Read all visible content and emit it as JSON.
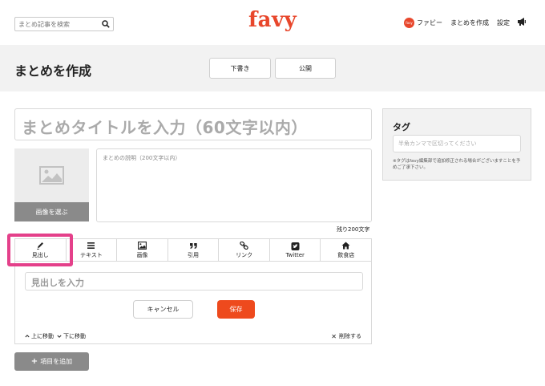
{
  "header": {
    "search_placeholder": "まとめ記事を検索",
    "logo": "favy",
    "avatar_text": "favy",
    "user_name": "ファビー",
    "nav_create": "まとめを作成",
    "nav_settings": "設定"
  },
  "band": {
    "title": "まとめを作成",
    "draft_label": "下書き",
    "publish_label": "公開"
  },
  "main": {
    "title_placeholder": "まとめタイトルを入力（60文字以内）",
    "image_button": "画像を選ぶ",
    "desc_placeholder": "まとめの説明（200文字以内）",
    "remaining": "残り200文字"
  },
  "editor": {
    "tabs": [
      {
        "label": "見出し",
        "icon": "pencil-icon"
      },
      {
        "label": "テキスト",
        "icon": "menu-icon"
      },
      {
        "label": "画像",
        "icon": "image-icon"
      },
      {
        "label": "引用",
        "icon": "quote-icon"
      },
      {
        "label": "リンク",
        "icon": "link-icon"
      },
      {
        "label": "Twitter",
        "icon": "twitter-icon"
      },
      {
        "label": "飲食店",
        "icon": "home-icon"
      }
    ],
    "heading_placeholder": "見出しを入力",
    "cancel_label": "キャンセル",
    "save_label": "保存",
    "move_up": "上に移動",
    "move_down": "下に移動",
    "delete_label": "削除する"
  },
  "add_item_label": "項目を追加",
  "tags": {
    "title": "タグ",
    "placeholder": "半角カンマで区切ってください",
    "note": "※タグはfavy編集部で追加修正される場合がございますことを予めご了承下さい。"
  },
  "colors": {
    "accent": "#ee4a1d",
    "logo": "#e8472c",
    "highlight": "#e4408a"
  }
}
